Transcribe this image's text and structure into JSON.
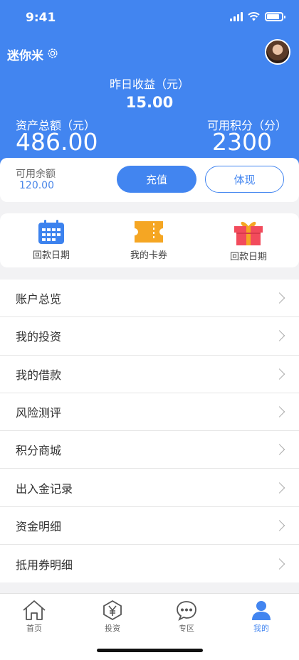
{
  "status_bar": {
    "time": "9:41"
  },
  "profile": {
    "username": "迷你米"
  },
  "earnings": {
    "yesterday_label": "昨日收益（元）",
    "yesterday_value": "15.00",
    "assets_label": "资产总额（元）",
    "assets_value": "486.00",
    "points_label": "可用积分（分）",
    "points_value": "2300"
  },
  "balance": {
    "label": "可用余额",
    "value": "120.00",
    "recharge_label": "充值",
    "withdraw_label": "体现"
  },
  "quick_actions": [
    {
      "label": "回款日期",
      "icon": "calendar-icon",
      "color": "#3c82ee"
    },
    {
      "label": "我的卡券",
      "icon": "ticket-icon",
      "color": "#f5a623"
    },
    {
      "label": "回款日期",
      "icon": "gift-icon",
      "color": "#f24b5c"
    }
  ],
  "menu": [
    {
      "label": "账户总览"
    },
    {
      "label": "我的投资"
    },
    {
      "label": "我的借款"
    },
    {
      "label": "风险测评"
    },
    {
      "label": "积分商城"
    },
    {
      "label": "出入金记录"
    },
    {
      "label": "资金明细"
    },
    {
      "label": "抵用券明细"
    }
  ],
  "tabbar": [
    {
      "label": "首页",
      "icon": "home-icon",
      "active": false
    },
    {
      "label": "投资",
      "icon": "yen-icon",
      "active": false
    },
    {
      "label": "专区",
      "icon": "chat-icon",
      "active": false
    },
    {
      "label": "我的",
      "icon": "user-icon",
      "active": true
    }
  ],
  "colors": {
    "primary": "#4285f0",
    "background": "#f2f2f4"
  }
}
